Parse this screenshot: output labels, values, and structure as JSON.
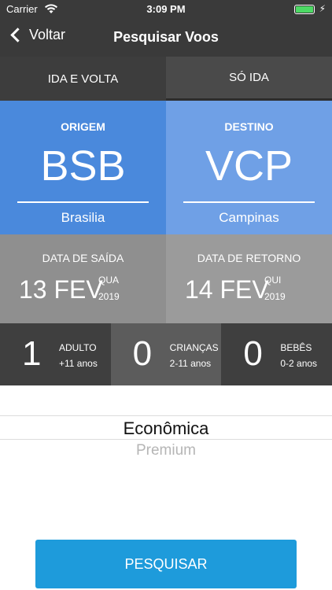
{
  "status_bar": {
    "carrier": "Carrier",
    "time": "3:09 PM"
  },
  "nav": {
    "back_label": "Voltar",
    "title": "Pesquisar Voos"
  },
  "trip_tabs": [
    {
      "label": "IDA E VOLTA",
      "selected": true
    },
    {
      "label": "SÓ IDA",
      "selected": false
    }
  ],
  "origin": {
    "label": "ORIGEM",
    "code": "BSB",
    "city": "Brasilia",
    "color": "#4a89dc"
  },
  "destination": {
    "label": "DESTINO",
    "code": "VCP",
    "city": "Campinas",
    "color": "#6fa0e6"
  },
  "departure": {
    "label": "DATA DE SAÍDA",
    "date": "13 FEV",
    "weekday": "QUA",
    "year": "2019"
  },
  "return": {
    "label": "DATA DE RETORNO",
    "date": "14 FEV",
    "weekday": "QUI",
    "year": "2019"
  },
  "passengers": [
    {
      "count": "1",
      "type": "ADULTO",
      "range": "+11 anos"
    },
    {
      "count": "0",
      "type": "CRIANÇAS",
      "range": "2-11 anos"
    },
    {
      "count": "0",
      "type": "BEBÊS",
      "range": "0-2 anos"
    }
  ],
  "cabin_class": {
    "selected": "Econômica",
    "next": "Premium"
  },
  "search_button": {
    "label": "PESQUISAR",
    "color": "#1e9bdb"
  },
  "colors": {
    "nav_bg": "#3a3a3a",
    "battery": "#4cd964"
  }
}
